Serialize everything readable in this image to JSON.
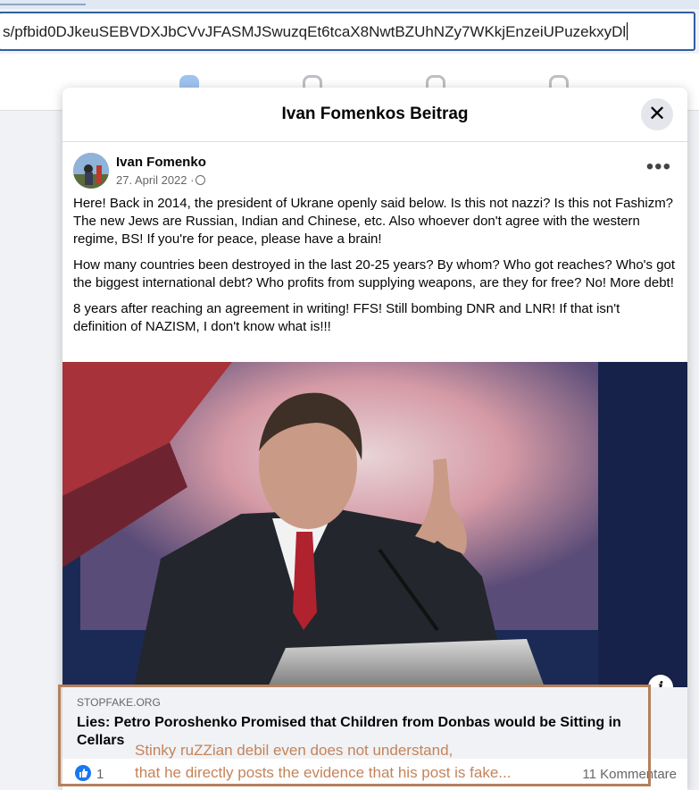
{
  "browser": {
    "url": "s/pfbid0DJkeuSEBVDXJbCVvJFASMJSwuzqEt6tcaX8NwtBZUhNZy7WKkjEnzeiUPuzekxyDl"
  },
  "dialog": {
    "title": "Ivan Fomenkos Beitrag",
    "close_icon": "close-icon"
  },
  "post": {
    "author": "Ivan Fomenko",
    "date": "27. April 2022 ·",
    "privacy_icon": "globe-icon",
    "more_icon": "more-options-icon",
    "paragraphs": [
      "Here! Back in 2014, the president of Ukrane openly said below. Is this not nazzi? Is this not Fashizm? The new Jews are Russian, Indian and Chinese, etc. Also whoever don't agree with the western regime, BS! If you're for peace, please have a brain!",
      "How many countries been destroyed in the last 20-25 years? By whom? Who got reaches? Who's got the biggest international debt? Who profits from supplying weapons, are they for free? No! More debt!",
      "8 years after reaching an agreement in writing! FFS! Still bombing DNR and LNR! If that isn't definition of NAZISM, I don't know what is!!!"
    ]
  },
  "link_preview": {
    "domain": "STOPFAKE.ORG",
    "title": "Lies: Petro Poroshenko Promised that Children from Donbas would be Sitting in Cellars",
    "info_icon": "info-icon"
  },
  "reactions": {
    "like_icon": "like-icon",
    "like_count": "1",
    "comments": "11 Kommentare"
  },
  "annotation": {
    "line1": "Stinky ruZZian debil even does not understand,",
    "line2": "that he directly posts the evidence that his post is fake...",
    "color": "#c58359",
    "border_color": "#b3805c"
  },
  "colors": {
    "facebook_blue": "#1877f2",
    "url_border": "#2e5f9e"
  }
}
